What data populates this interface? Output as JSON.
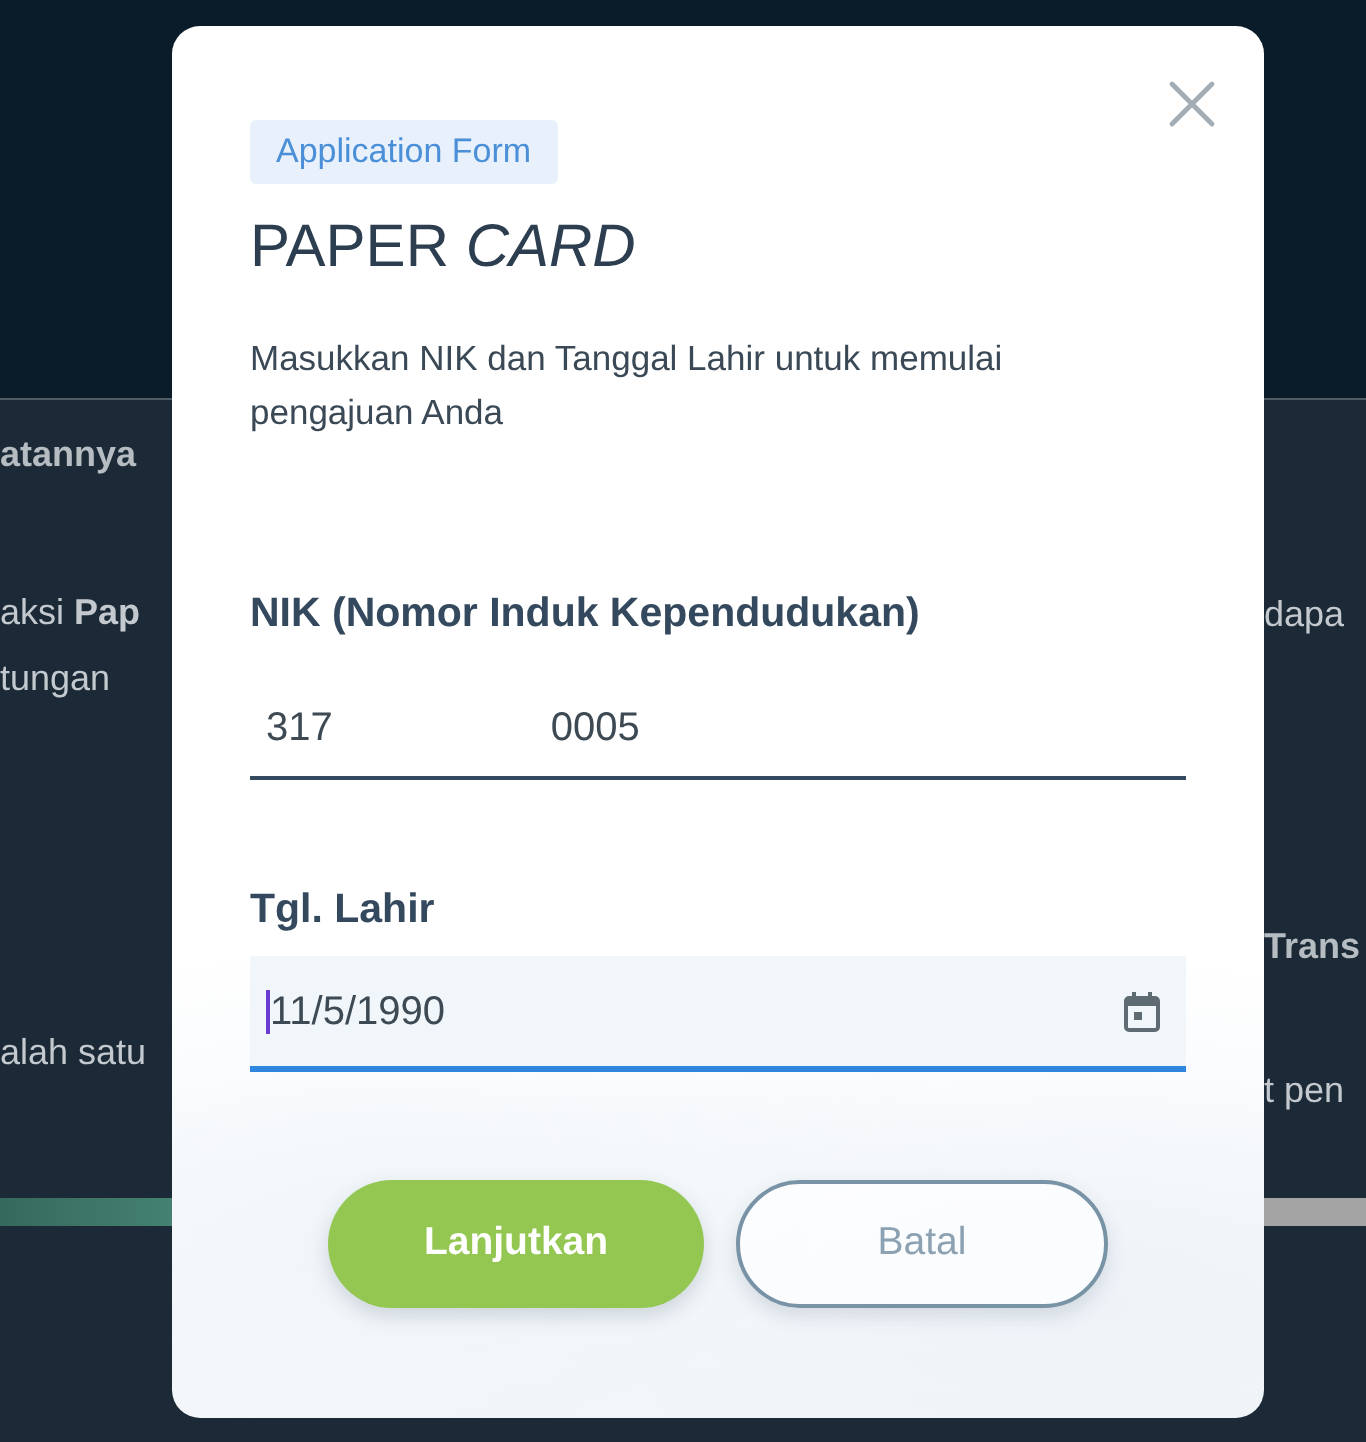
{
  "background_page": {
    "left_column": [
      {
        "kind": "heading",
        "text": "atannya"
      },
      {
        "kind": "body",
        "text": "aksi **Pap**"
      },
      {
        "kind": "body",
        "text": "tungan"
      },
      {
        "kind": "body",
        "text": "alah satu"
      }
    ],
    "right_column": [
      {
        "kind": "body",
        "text": "dapa"
      },
      {
        "kind": "heading",
        "text": "Trans"
      },
      {
        "kind": "body",
        "text": "t pen"
      }
    ]
  },
  "dialog": {
    "badge": "Application Form",
    "title": "PAPER *CARD*",
    "description": "Masukkan NIK dan Tanggal Lahir untuk memulai pengajuan Anda",
    "fields": [
      {
        "kind": "text",
        "label": "NIK (Nomor Induk Kependudukan)",
        "value_parts": [
          "317",
          "0005"
        ],
        "focused": false
      },
      {
        "kind": "date",
        "label": "Tgl. Lahir",
        "value": "11/5/1990",
        "focused": true
      }
    ],
    "buttons": [
      {
        "kind": "primary",
        "label": "Lanjutkan"
      },
      {
        "kind": "secondary",
        "label": "Batal"
      }
    ]
  }
}
